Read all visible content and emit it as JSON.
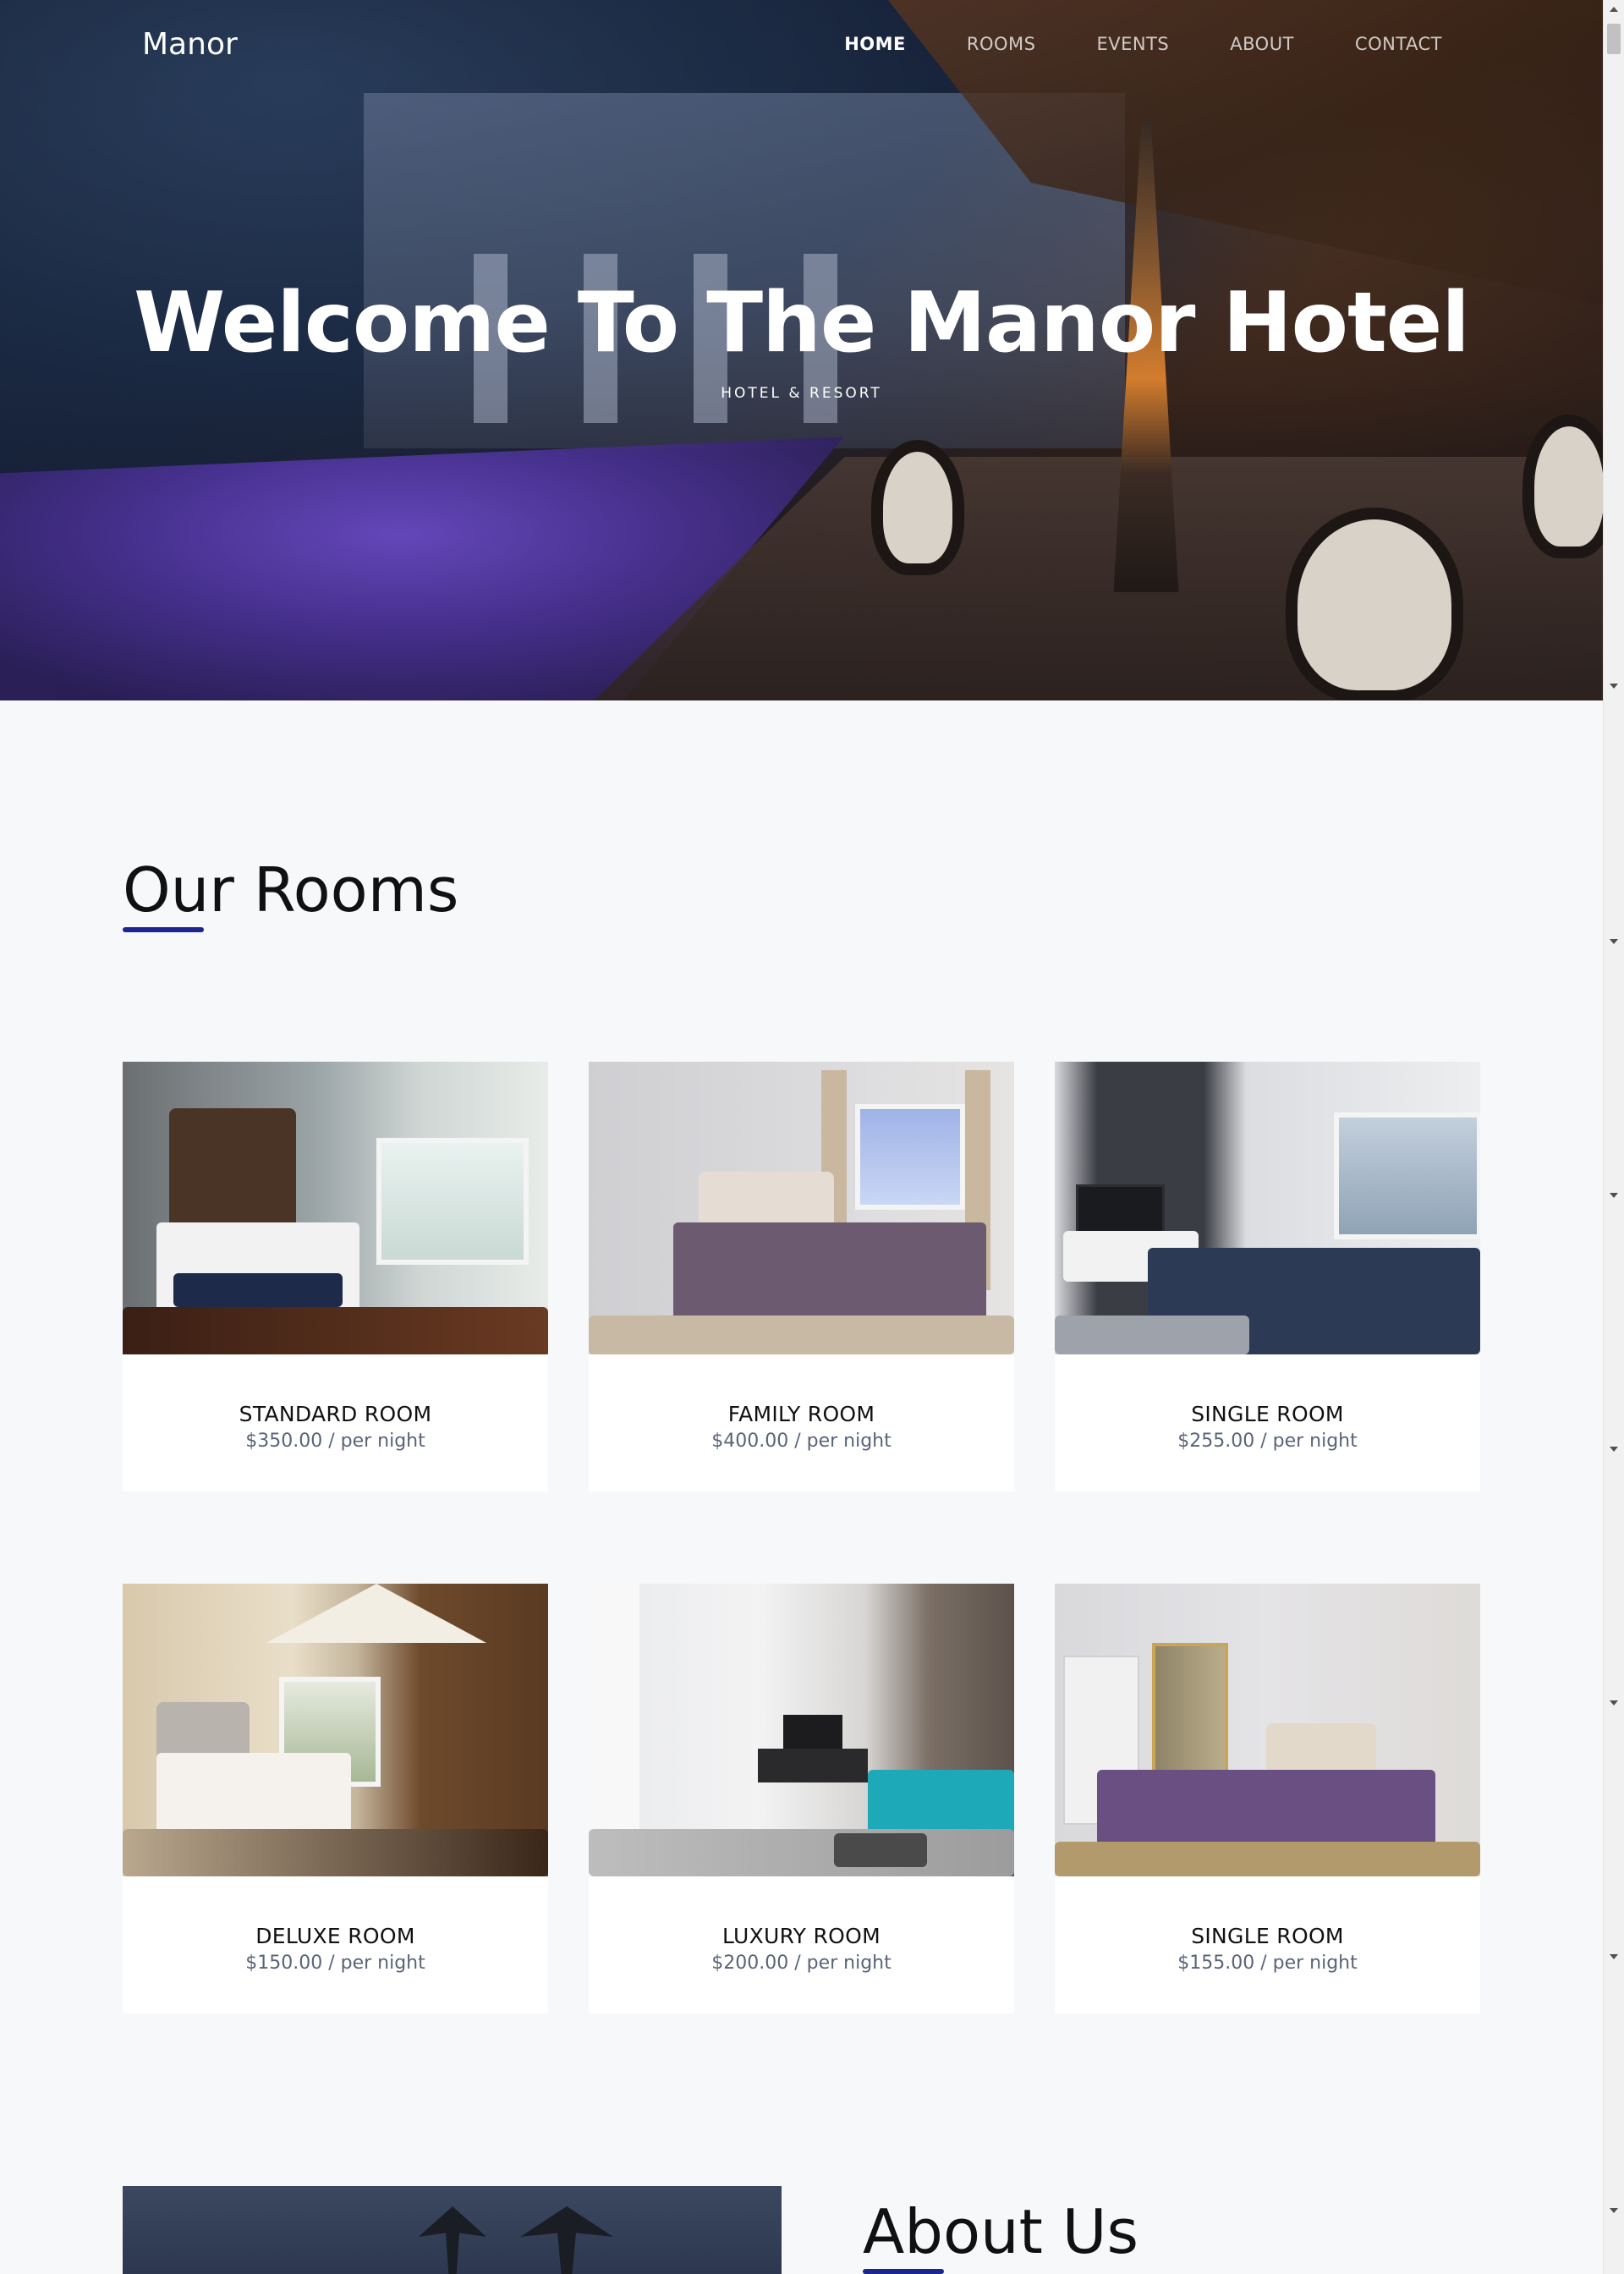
{
  "header": {
    "logo": "Manor",
    "nav": [
      {
        "label": "HOME",
        "active": true
      },
      {
        "label": "ROOMS",
        "active": false
      },
      {
        "label": "EVENTS",
        "active": false
      },
      {
        "label": "ABOUT",
        "active": false
      },
      {
        "label": "CONTACT",
        "active": false
      }
    ]
  },
  "hero": {
    "title": "Welcome To The Manor Hotel",
    "subtitle": "HOTEL & RESORT"
  },
  "rooms": {
    "title": "Our Rooms",
    "items": [
      {
        "name": "STANDARD ROOM",
        "price": "$350.00 / per night"
      },
      {
        "name": "FAMILY ROOM",
        "price": "$400.00 / per night"
      },
      {
        "name": "SINGLE ROOM",
        "price": "$255.00 / per night"
      },
      {
        "name": "DELUXE ROOM",
        "price": "$150.00 / per night"
      },
      {
        "name": "LUXURY ROOM",
        "price": "$200.00 / per night"
      },
      {
        "name": "SINGLE ROOM",
        "price": "$155.00 / per night"
      }
    ]
  },
  "about": {
    "title": "About Us"
  },
  "colors": {
    "accent": "#1b2690",
    "page_background": "#f7f8fa",
    "price_text": "#5a6478"
  }
}
